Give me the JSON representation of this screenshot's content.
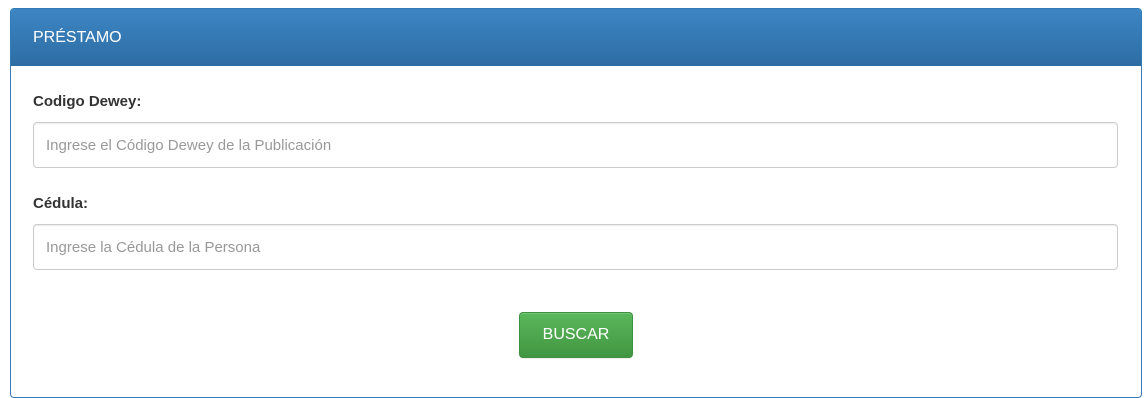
{
  "panel": {
    "title": "PRÉSTAMO"
  },
  "form": {
    "dewey": {
      "label": "Codigo Dewey:",
      "value": "",
      "placeholder": "Ingrese el Código Dewey de la Publicación"
    },
    "cedula": {
      "label": "Cédula:",
      "value": "",
      "placeholder": "Ingrese la Cédula de la Persona"
    },
    "submit_label": "BUSCAR"
  },
  "colors": {
    "header_bg": "#337ab7",
    "button_bg": "#5cb85c"
  }
}
